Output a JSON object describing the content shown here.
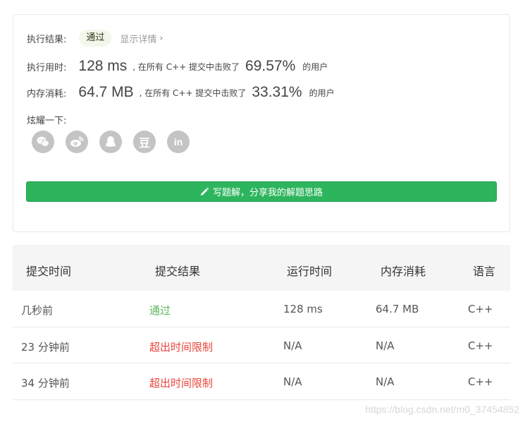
{
  "result": {
    "status_label": "执行结果:",
    "status_badge": "通过",
    "details_link": "显示详情",
    "runtime_label": "执行用时:",
    "runtime_value": "128 ms",
    "runtime_text": ", 在所有 C++ 提交中击败了",
    "runtime_percent": "69.57%",
    "runtime_suffix": "的用户",
    "memory_label": "内存消耗:",
    "memory_value": "64.7 MB",
    "memory_text": ", 在所有 C++ 提交中击败了",
    "memory_percent": "33.31%",
    "memory_suffix": "的用户",
    "share_label": "炫耀一下:",
    "share_icons": [
      "wechat-icon",
      "weibo-icon",
      "qq-icon",
      "douban-icon",
      "linkedin-icon"
    ],
    "douban_glyph": "豆",
    "linkedin_glyph": "in",
    "write_button": "写题解，分享我的解题思路",
    "accent_color": "#2db55d"
  },
  "submissions": {
    "headers": [
      "提交时间",
      "提交结果",
      "运行时间",
      "内存消耗",
      "语言"
    ],
    "rows": [
      {
        "time": "几秒前",
        "result": "通过",
        "runtime": "128 ms",
        "memory": "64.7 MB",
        "lang": "C++"
      },
      {
        "time": "23 分钟前",
        "result": "超出时间限制",
        "runtime": "N/A",
        "memory": "N/A",
        "lang": "C++"
      },
      {
        "time": "34 分钟前",
        "result": "超出时间限制",
        "runtime": "N/A",
        "memory": "N/A",
        "lang": "C++"
      }
    ],
    "status_colors": {
      "accepted": "#5cb85c",
      "time_limit_exceeded": "#e8453c"
    }
  },
  "watermark": "https://blog.csdn.net/m0_37454852"
}
